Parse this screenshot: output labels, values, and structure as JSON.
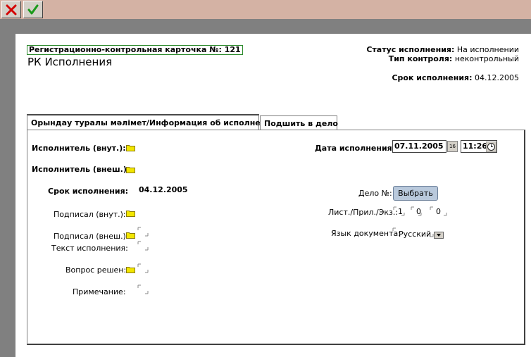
{
  "toolbar": {
    "close_icon": "close-x-icon",
    "ok_icon": "checkmark-icon"
  },
  "header": {
    "card_number": "Регистрационно-контрольная карточка №: 121",
    "title": "РК Исполнения",
    "status_label": "Статус исполнения:",
    "status_value": "На исполнении",
    "control_label": "Тип контроля:",
    "control_value": "неконтрольный",
    "deadline_label": "Срок исполнения:",
    "deadline_value": "04.12.2005"
  },
  "tabs": [
    {
      "label": "Орындау туралы мәлімет/Информация об исполнении"
    },
    {
      "label": "Подшить в дело"
    }
  ],
  "form": {
    "executor_internal": "Исполнитель (внут.):",
    "executor_external": "Исполнитель (внеш.):",
    "deadline_label": "Срок исполнения:",
    "deadline_value": "04.12.2005",
    "signed_internal": "Подписал (внут.):",
    "signed_external": "Подписал (внеш.):",
    "execution_text": "Текст исполнения:",
    "question_resolved": "Вопрос решен:",
    "note": "Примечание:",
    "exec_date_label": "Дата исполнения:",
    "exec_date_value": "07.11.2005",
    "calendar_label": "16",
    "exec_time_value": "11:26",
    "case_label": "Дело №:",
    "choose_button": "Выбрать",
    "sheets_label": "Лист./Прил./Экз.:",
    "sheets_value": "1",
    "attach_value": "0",
    "copies_value": "0",
    "language_label": "Язык документа:",
    "language_value": "Русский"
  },
  "colors": {
    "toolbar_bg": "#d4b2a4",
    "card_border": "#2e8b2e",
    "folder": "#f2e600"
  }
}
